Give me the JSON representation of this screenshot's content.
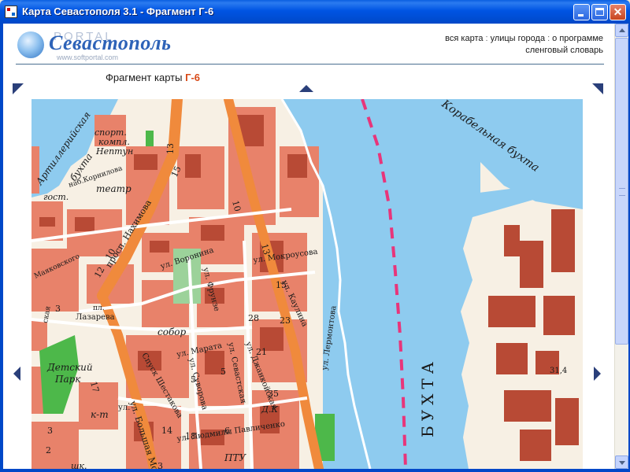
{
  "window": {
    "title": "Карта Севастополя 3.1 - Фрагмент Г-6",
    "buttons": {
      "minimize": "minimize",
      "maximize": "maximize",
      "close": "close"
    }
  },
  "header": {
    "logo_text": "Севастополь",
    "watermark": "PORTAL",
    "watermark_url": "www.softportal.com",
    "nav": {
      "all_map": "вся карта",
      "streets": "улицы города",
      "about": "о программе",
      "slang": "сленговый словарь"
    }
  },
  "fragment": {
    "label": "Фрагмент карты",
    "code": "Г-6"
  },
  "map": {
    "labels": {
      "korabelnaya": "Корабельная бухта",
      "artilleriyskaya_1": "Артиллерийская",
      "artilleriyskaya_2": "бухта",
      "sport_complex_1": "спорт.",
      "sport_complex_2": "компл.",
      "sport_complex_3": "Нептун",
      "nab_kornilova": "наб.Корнилова",
      "teatr": "театр",
      "gost": "гост.",
      "pr_nakhimova": "просп. Нахимова",
      "ul_voronina": "ул. Воронина",
      "ul_frunze": "ул. Фрунзе",
      "ul_mokrousova": "ул. Мокроусова",
      "ul_kaulina": "ул. Каулина",
      "manyakovskogo": "Маяковского",
      "pl_lazareva_1": "пл.",
      "pl_lazareva_2": "Лазарева",
      "sobor": "собор",
      "ul_marata": "ул. Марата",
      "ul_lermontova": "ул. Лермонтова",
      "bukhta": "БУХТА",
      "elevation": "31,4",
      "detskiy_park_1": "Детский",
      "detskiy_park_2": "Парк",
      "kt": "к-т",
      "spusk_shestakova": "Спуск Шестакова",
      "ul_suvorova": "ул. Суворова",
      "ul_sevastskaya": "ул. Севастская",
      "ul_dzhankoyskaya": "ул. Джанкойская",
      "dk": "Д.К",
      "ul_pavlichenko": "ул. Людмилы Павличенко",
      "ptu": "ПТУ",
      "ul_bolshaya_morskaya": "ул. Большая Мо",
      "shk": "шк.",
      "ulitsa_short": "ул.",
      "skaya": "ская",
      "n13a": "13",
      "n15a": "15",
      "n12": "12",
      "n10a": "10",
      "n3a": "3",
      "n10b": "10",
      "n13b": "13",
      "n28": "28",
      "n23": "23",
      "n15b": "15",
      "n5a": "5",
      "n5b": "5",
      "n21": "21",
      "n35": "35",
      "n18": "18",
      "n17": "17",
      "n3b": "3",
      "n2": "2",
      "n3c": "3",
      "n14": "14",
      "n6": "6"
    }
  },
  "colors": {
    "water": "#8ecbef",
    "land": "#f7f0e4",
    "blocks": "#e8826a",
    "buildings": "#b84a35",
    "main_roads": "#f08a3c",
    "parks": "#4db84a",
    "fairway": "#e8357a"
  }
}
